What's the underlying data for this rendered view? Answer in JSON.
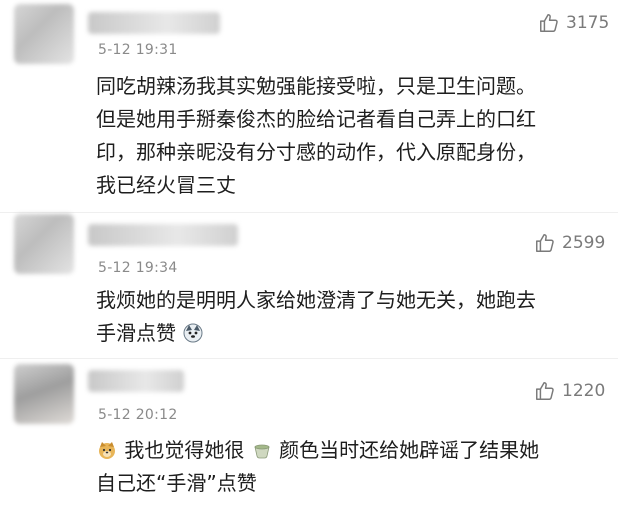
{
  "comments": [
    {
      "time": "5-12 19:31",
      "likes": "3175",
      "lines": [
        "同吃胡辣汤我其实勉强能接受啦，只是卫生问题。",
        "但是她用手掰秦俊杰的脸给记者看自己弄上的口红",
        "印，那种亲昵没有分寸感的动作，代入原配身份，",
        "我已经火冒三丈"
      ]
    },
    {
      "time": "5-12 19:34",
      "likes": "2599",
      "line1": "我烦她的是明明人家给她澄清了与她无关，她跑去",
      "line2": "手滑点赞",
      "emoji": "husky-emoji"
    },
    {
      "time": "5-12 20:12",
      "likes": "1220",
      "line1_part1": "我也觉得她很",
      "line1_part2": "颜色当时还给她辟谣了结果她",
      "line2": "自己还“手滑”点赞",
      "emoji1": "doge-emoji",
      "emoji2": "green-tea-emoji"
    }
  ],
  "icons": {
    "like": "thumbs-up-icon"
  }
}
